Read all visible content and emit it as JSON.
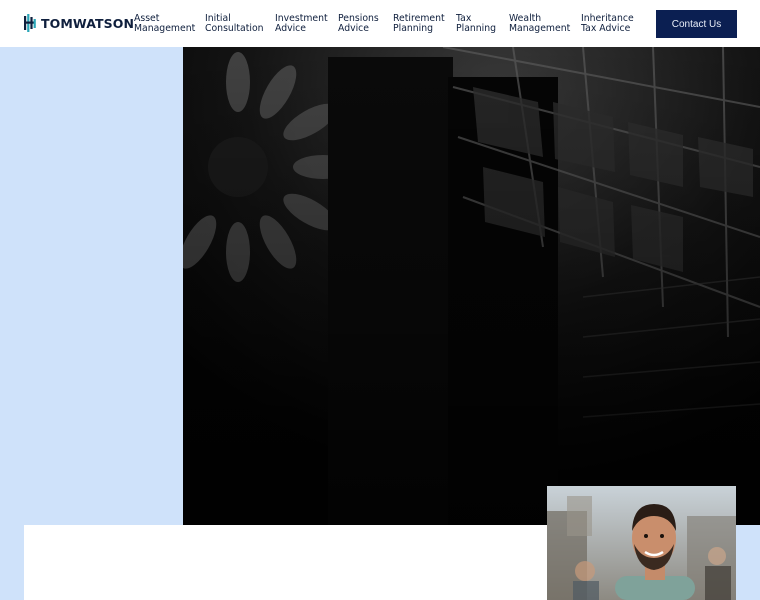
{
  "brand": {
    "name": "TOMWATSON",
    "colors": {
      "navy": "#0f1f3d",
      "button": "#0b1f52",
      "light_blue": "#cfe2fa",
      "accent_teal": "#2aa6b8"
    }
  },
  "nav": {
    "items": [
      {
        "line1": "Asset",
        "line2": "Management"
      },
      {
        "line1": "Initial",
        "line2": "Consultation"
      },
      {
        "line1": "Investment",
        "line2": "Advice"
      },
      {
        "line1": "Pensions",
        "line2": "Advice"
      },
      {
        "line1": "Retirement",
        "line2": "Planning"
      },
      {
        "line1": "Tax",
        "line2": "Planning"
      },
      {
        "line1": "Wealth",
        "line2": "Management"
      },
      {
        "line1": "Inheritance",
        "line2": "Tax Advice"
      }
    ],
    "contact_label": "Contact Us"
  },
  "hero": {
    "image_icon": "architecture-interior-photo",
    "person_icon": "advisor-portrait-photo"
  }
}
